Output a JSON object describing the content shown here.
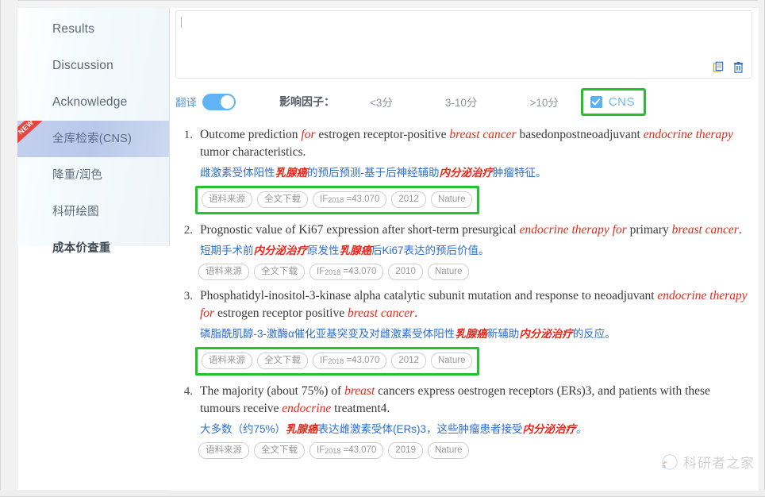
{
  "sidebar": {
    "items": [
      {
        "label": "Results",
        "active": false,
        "bold": false,
        "badge": ""
      },
      {
        "label": "Discussion",
        "active": false,
        "bold": false,
        "badge": ""
      },
      {
        "label": "Acknowledge",
        "active": false,
        "bold": false,
        "badge": ""
      },
      {
        "label": "全库检索(CNS)",
        "active": true,
        "bold": false,
        "badge": "NEW"
      },
      {
        "label": "降重/润色",
        "active": false,
        "bold": false,
        "badge": ""
      },
      {
        "label": "科研绘图",
        "active": false,
        "bold": false,
        "badge": ""
      },
      {
        "label": "成本价查重",
        "active": false,
        "bold": true,
        "badge": ""
      }
    ]
  },
  "editor": {
    "value": "",
    "placeholder": "",
    "copy_icon": "copy-icon",
    "delete_icon": "trash-icon"
  },
  "toolbar": {
    "translate_label": "翻译",
    "translate_on": true,
    "impact_factor_label": "影响因子：",
    "filters": [
      "<3分",
      "3-10分",
      ">10分"
    ],
    "cns_label": "CNS",
    "cns_checked": true,
    "highlight_color": "#22c32a",
    "accent_color": "#5b9bd5"
  },
  "results": [
    {
      "index": "1.",
      "title_parts": [
        {
          "t": "Outcome prediction ",
          "hl": false
        },
        {
          "t": "for",
          "hl": true
        },
        {
          "t": " estrogen receptor-positive ",
          "hl": false
        },
        {
          "t": "breast cancer",
          "hl": true
        },
        {
          "t": " basedonpostneoadjuvant ",
          "hl": false
        },
        {
          "t": "endocrine therapy",
          "hl": true
        },
        {
          "t": " tumor characteristics.",
          "hl": false
        }
      ],
      "cn_parts": [
        {
          "t": "雌激素受体阳性",
          "hl": false
        },
        {
          "t": "乳腺癌",
          "hl": true
        },
        {
          "t": "的预后预测-基于后神经辅助",
          "hl": false
        },
        {
          "t": "内分泌治疗",
          "hl": true
        },
        {
          "t": "肿瘤特征。",
          "hl": false
        }
      ],
      "tags": [
        "语料来源",
        "全文下载",
        "IF2018 =43.070",
        "2012",
        "Nature"
      ],
      "tags_highlighted": true
    },
    {
      "index": "2.",
      "title_parts": [
        {
          "t": "Prognostic value of Ki67 expression after short-term presurgical ",
          "hl": false
        },
        {
          "t": "endocrine therapy for",
          "hl": true
        },
        {
          "t": " primary ",
          "hl": false
        },
        {
          "t": "breast cancer",
          "hl": true
        },
        {
          "t": ".",
          "hl": false
        }
      ],
      "cn_parts": [
        {
          "t": "短期手术前",
          "hl": false
        },
        {
          "t": "内分泌治疗",
          "hl": true
        },
        {
          "t": "原发性",
          "hl": false
        },
        {
          "t": "乳腺癌",
          "hl": true
        },
        {
          "t": "后Ki67表达的预后价值。",
          "hl": false
        }
      ],
      "tags": [
        "语料来源",
        "全文下载",
        "IF2018 =43.070",
        "2010",
        "Nature"
      ],
      "tags_highlighted": false
    },
    {
      "index": "3.",
      "title_parts": [
        {
          "t": "Phosphatidyl-inositol-3-kinase alpha catalytic subunit mutation and response to neoadjuvant ",
          "hl": false
        },
        {
          "t": "endocrine therapy for",
          "hl": true
        },
        {
          "t": " estrogen receptor positive ",
          "hl": false
        },
        {
          "t": "breast cancer",
          "hl": true
        },
        {
          "t": ".",
          "hl": false
        }
      ],
      "cn_parts": [
        {
          "t": "磷脂酰肌醇-3-激酶α催化亚基突变及对雌激素受体阳性",
          "hl": false
        },
        {
          "t": "乳腺癌",
          "hl": true
        },
        {
          "t": "新辅助",
          "hl": false
        },
        {
          "t": "内分泌治疗",
          "hl": true
        },
        {
          "t": "的反应。",
          "hl": false
        }
      ],
      "tags": [
        "语料来源",
        "全文下载",
        "IF2018 =43.070",
        "2012",
        "Nature"
      ],
      "tags_highlighted": true
    },
    {
      "index": "4.",
      "title_parts": [
        {
          "t": "The majority (about 75%) of ",
          "hl": false
        },
        {
          "t": "breast",
          "hl": true
        },
        {
          "t": " cancers express oestrogen receptors (ERs)3, and patients with these tumours receive ",
          "hl": false
        },
        {
          "t": "endocrine",
          "hl": true
        },
        {
          "t": " treatment4.",
          "hl": false
        }
      ],
      "cn_parts": [
        {
          "t": "大多数（约75%）",
          "hl": false
        },
        {
          "t": "乳腺癌",
          "hl": true
        },
        {
          "t": "表达雌激素受体(ERs)3，这些肿瘤患者接受",
          "hl": false
        },
        {
          "t": "内分泌治疗",
          "hl": true
        },
        {
          "t": "。",
          "hl": false
        }
      ],
      "tags": [
        "语料来源",
        "全文下载",
        "IF2018 =43.070",
        "2019",
        "Nature"
      ],
      "tags_highlighted": false
    }
  ],
  "watermark": {
    "text": "科研者之家"
  }
}
